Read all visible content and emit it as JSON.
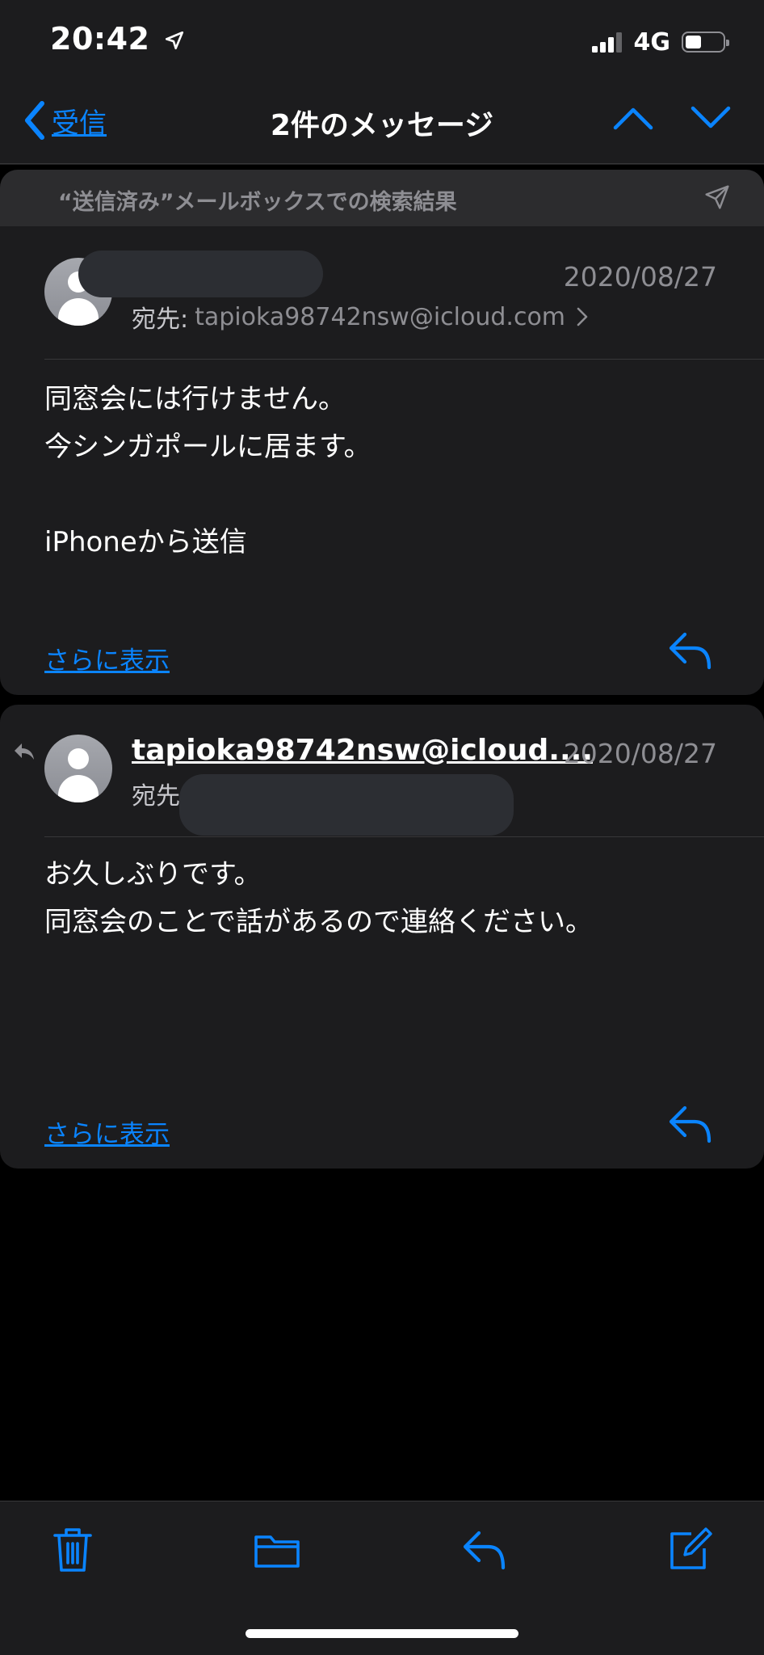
{
  "status_bar": {
    "time": "20:42",
    "network": "4G",
    "battery_level": 0.45
  },
  "nav": {
    "back_label": "受信",
    "title": "2件のメッセージ"
  },
  "search_banner": {
    "text": "“送信済み”メールボックスでの検索結果"
  },
  "messages": [
    {
      "date": "2020/08/27",
      "to_label": "宛先:",
      "to_address": "tapioka98742nsw@icloud.com",
      "body_lines": [
        "同窓会には行けません。",
        "今シンガポールに居ます。",
        "",
        "iPhoneから送信"
      ],
      "show_more": "さらに表示"
    },
    {
      "sender": "tapioka98742nsw@icloud....",
      "date": "2020/08/27",
      "to_label": "宛先",
      "body_lines": [
        "お久しぶりです。",
        "同窓会のことで話があるので連絡ください。"
      ],
      "show_more": "さらに表示"
    }
  ],
  "colors": {
    "accent": "#0a84ff",
    "background": "#000000",
    "card": "#1c1c1e",
    "secondary_text": "#8e8e93"
  },
  "icons": {
    "nav": [
      "location-arrow-icon",
      "chevron-left-icon",
      "chevron-up-icon",
      "chevron-down-icon",
      "send-icon"
    ],
    "toolbar": [
      "trash-icon",
      "folder-icon",
      "reply-icon",
      "compose-icon"
    ]
  }
}
